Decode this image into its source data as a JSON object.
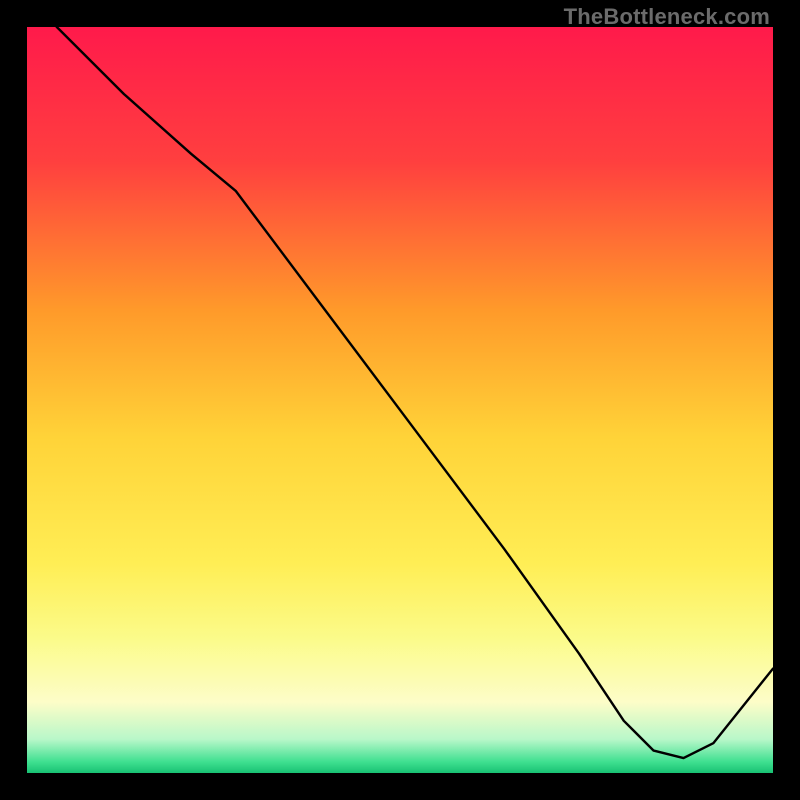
{
  "watermark": "TheBottleneck.com",
  "small_label": "",
  "chart_data": {
    "type": "line",
    "title": "",
    "xlabel": "",
    "ylabel": "",
    "xlim": [
      0,
      100
    ],
    "ylim": [
      0,
      100
    ],
    "grid": false,
    "legend": false,
    "background_gradient": {
      "orientation": "vertical",
      "stops": [
        {
          "pos": 0.0,
          "color": "#ff1a4b"
        },
        {
          "pos": 0.18,
          "color": "#ff3f3f"
        },
        {
          "pos": 0.38,
          "color": "#ff9a2a"
        },
        {
          "pos": 0.55,
          "color": "#ffd338"
        },
        {
          "pos": 0.72,
          "color": "#ffee55"
        },
        {
          "pos": 0.82,
          "color": "#fbfb8a"
        },
        {
          "pos": 0.905,
          "color": "#fdfdc8"
        },
        {
          "pos": 0.955,
          "color": "#b8f7c9"
        },
        {
          "pos": 0.985,
          "color": "#3fe090"
        },
        {
          "pos": 1.0,
          "color": "#18c173"
        }
      ]
    },
    "series": [
      {
        "name": "bottleneck-curve",
        "color": "#000000",
        "x": [
          0,
          4,
          13,
          22,
          28,
          40,
          52,
          64,
          74,
          80,
          84,
          88,
          92,
          100
        ],
        "y": [
          105,
          100,
          91,
          83,
          78,
          62,
          46,
          30,
          16,
          7,
          3,
          2,
          4,
          14
        ]
      }
    ],
    "annotations": [
      {
        "name": "valley-label",
        "x": 82,
        "y": 2.5,
        "text": "",
        "color": "#c02a2a"
      }
    ]
  }
}
